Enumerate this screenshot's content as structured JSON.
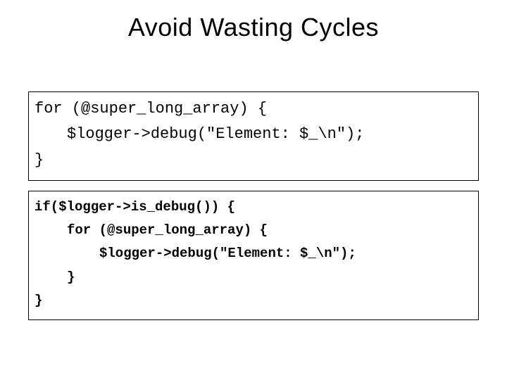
{
  "title": "Avoid Wasting Cycles",
  "box1": {
    "line1": "for (@super_long_array) {",
    "line2": "$logger->debug(\"Element: $_\\n\");",
    "line3": "}"
  },
  "box2": {
    "line1": "if($logger->is_debug()) {",
    "line2": "for (@super_long_array) {",
    "line3": "$logger->debug(\"Element: $_\\n\");",
    "line4": "}",
    "line5": "}"
  }
}
